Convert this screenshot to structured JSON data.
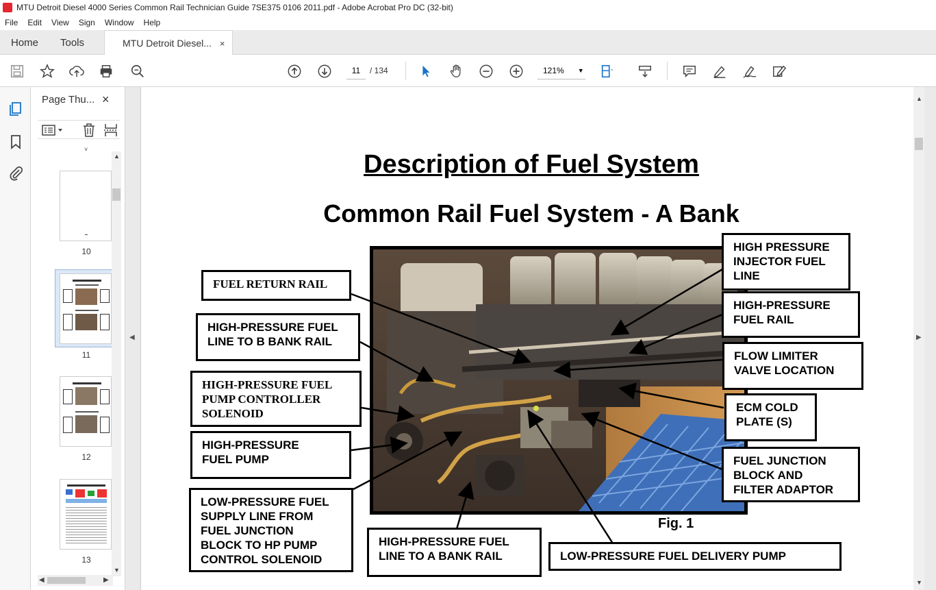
{
  "window": {
    "title": "MTU Detroit Diesel 4000 Series Common Rail Technician Guide 7SE375 0106 2011.pdf - Adobe Acrobat Pro DC (32-bit)"
  },
  "menu": [
    "File",
    "Edit",
    "View",
    "Sign",
    "Window",
    "Help"
  ],
  "tabs": {
    "home": "Home",
    "tools": "Tools",
    "doc": "MTU Detroit Diesel...",
    "close": "×"
  },
  "toolbar": {
    "page_current": "11",
    "page_total": "/ 134",
    "zoom": "121%"
  },
  "icons": {
    "save": "save-icon",
    "star": "star-icon",
    "upload": "upload-icon",
    "print": "print-icon",
    "search": "zoom-search-icon",
    "prev": "arrow-up-circle-icon",
    "next": "arrow-down-circle-icon",
    "select": "cursor-icon",
    "hand": "hand-icon",
    "zoom_out": "zoom-out-icon",
    "zoom_in": "zoom-in-icon",
    "fit": "fit-page-icon",
    "scroll": "scroll-mode-icon",
    "comment": "comment-icon",
    "highlight": "pen-icon",
    "sign": "sign-icon",
    "edit": "edit-pdf-icon"
  },
  "panel": {
    "title": "Page Thu...",
    "close": "×",
    "thumbnails": [
      {
        "label": "10"
      },
      {
        "label": "11"
      },
      {
        "label": "12"
      },
      {
        "label": "13"
      }
    ]
  },
  "document": {
    "title": "Description of Fuel System",
    "subtitle": "Common Rail Fuel System - A Bank",
    "figure": "Fig. 1",
    "callouts": {
      "fuel_return_rail": "FUEL RETURN RAIL",
      "hp_line_b_bank": "HIGH-PRESSURE FUEL\nLINE TO B BANK RAIL",
      "hp_pump_controller": "HIGH-PRESSURE FUEL\nPUMP CONTROLLER\nSOLENOID",
      "hp_fuel_pump": "HIGH-PRESSURE\nFUEL PUMP",
      "lp_supply_line": "LOW-PRESSURE FUEL\nSUPPLY LINE FROM\nFUEL JUNCTION\nBLOCK TO HP PUMP\nCONTROL SOLENOID",
      "hp_line_a_bank": "HIGH-PRESSURE FUEL\nLINE TO A BANK RAIL",
      "lp_delivery_pump": "LOW-PRESSURE FUEL DELIVERY PUMP",
      "hp_injector_line": "HIGH PRESSURE\nINJECTOR FUEL\nLINE",
      "hp_fuel_rail": "HIGH-PRESSURE\nFUEL RAIL",
      "flow_limiter": "FLOW LIMITER\nVALVE LOCATION",
      "ecm_cold_plate": "ECM COLD\nPLATE (S)",
      "fuel_junction": "FUEL JUNCTION\nBLOCK AND\nFILTER ADAPTOR"
    }
  }
}
